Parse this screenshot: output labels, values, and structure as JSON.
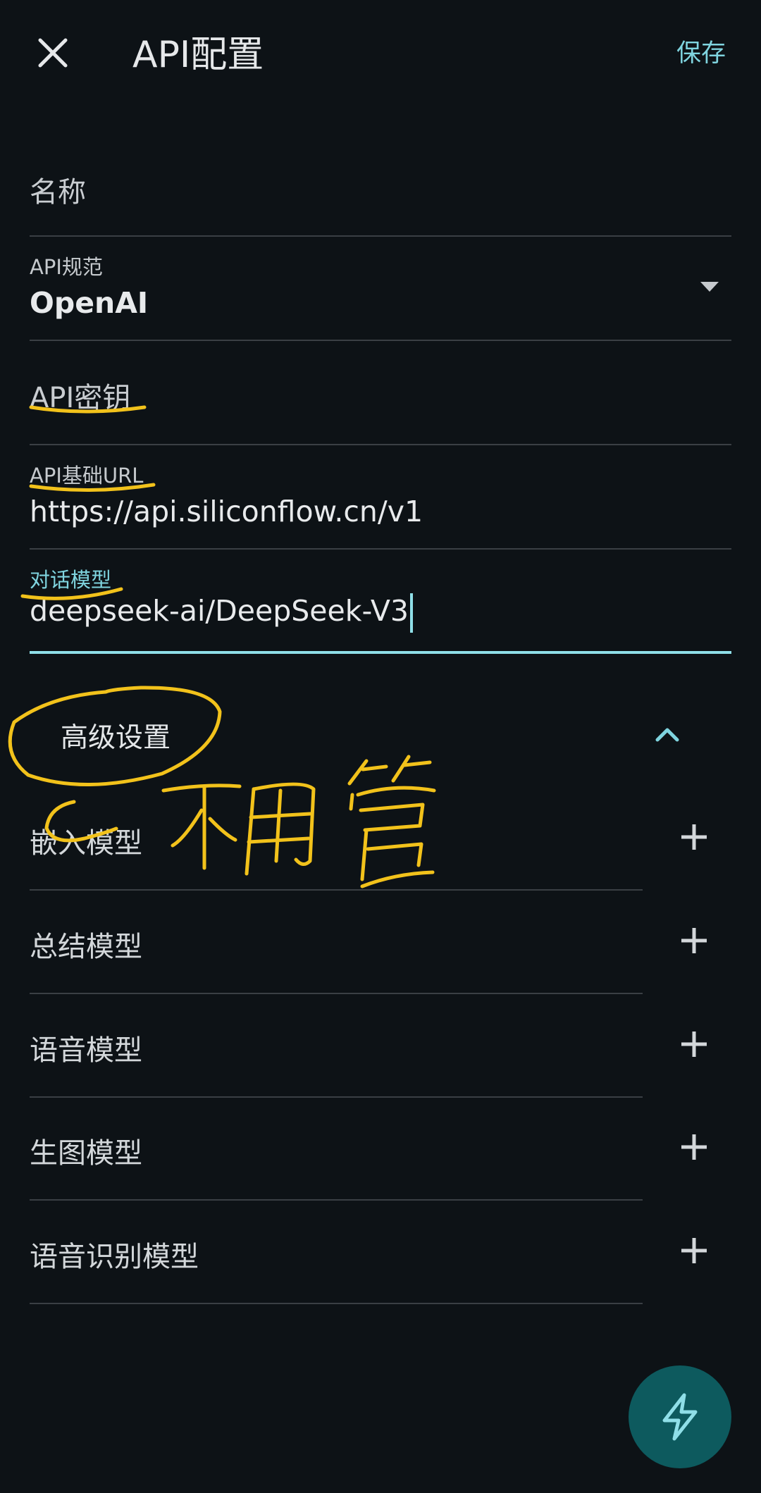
{
  "header": {
    "close_icon": "close-icon",
    "title": "API配置",
    "save_label": "保存"
  },
  "form": {
    "name_label": "名称",
    "api_spec_label": "API规范",
    "api_spec_value": "OpenAI",
    "api_key_label": "API密钥",
    "base_url_label": "API基础URL",
    "base_url_value": "https://api.siliconflow.cn/v1",
    "chat_model_label": "对话模型",
    "chat_model_value": "deepseek-ai/DeepSeek-V3"
  },
  "advanced": {
    "title": "高级设置",
    "chevron_icon": "chevron-up-icon",
    "models": [
      {
        "label": "嵌入模型"
      },
      {
        "label": "总结模型"
      },
      {
        "label": "语音模型"
      },
      {
        "label": "生图模型"
      },
      {
        "label": "语音识别模型"
      }
    ]
  },
  "fab": {
    "icon": "lightning-icon"
  },
  "annotation": {
    "handwritten_text": "不用管"
  },
  "colors": {
    "background": "#0d1216",
    "accent": "#7fd4df",
    "fab": "#0d5a5e",
    "annotation": "#f2c21b"
  }
}
